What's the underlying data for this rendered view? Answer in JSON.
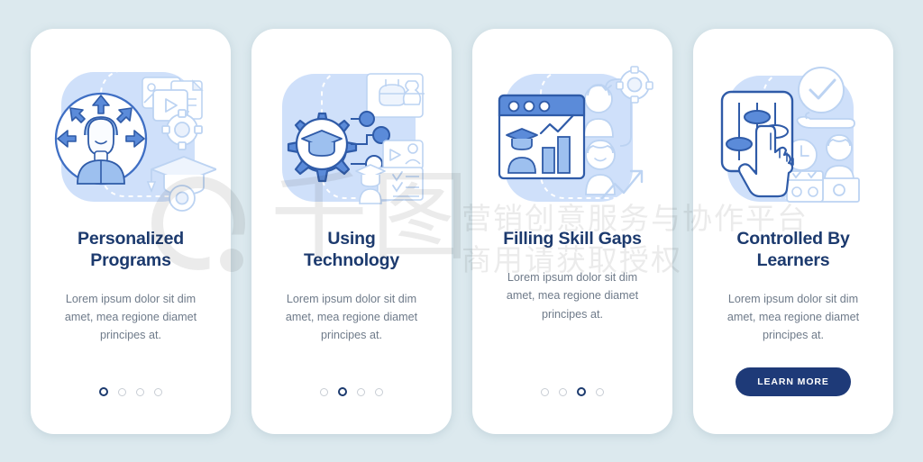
{
  "page": {
    "background_color": "#dce9ee",
    "card_background": "#ffffff",
    "title_color": "#1c3a6e",
    "body_color": "#6f7b8a",
    "accent_blue": "#5b8bd9",
    "light_blue": "#cddef7",
    "cta_color": "#1e3a78"
  },
  "watermark": {
    "brand_mark": "Q",
    "brand_cn": "千图",
    "line1": "营销创意服务与协作平台",
    "line2": "商用请获取授权"
  },
  "screens": [
    {
      "id": "personalized-programs",
      "illustration": "person-in-circle-with-arrows-media-graduation-cap-gears",
      "title": "Personalized Programs",
      "title_line1": "Personalized",
      "title_line2": "Programs",
      "body": "Lorem ipsum dolor sit dim amet, mea regione diamet principes at.",
      "footer_type": "dots",
      "dots": {
        "count": 4,
        "active_index": 0
      }
    },
    {
      "id": "using-technology",
      "illustration": "gear-with-graduation-cap-nodes-vr-headset-video-card",
      "title": "Using Technology",
      "title_line1": "Using",
      "title_line2": "Technology",
      "body": "Lorem ipsum dolor sit dim amet, mea regione diamet principes at.",
      "footer_type": "dots",
      "dots": {
        "count": 4,
        "active_index": 1
      }
    },
    {
      "id": "filling-skill-gaps",
      "illustration": "browser-window-graduate-bar-chart-people-gear-growth-arrow",
      "title": "Filling Skill Gaps",
      "title_line1": "Filling Skill Gaps",
      "title_line2": "",
      "body": "Lorem ipsum dolor sit dim amet, mea regione diamet principes at.",
      "footer_type": "dots",
      "dots": {
        "count": 4,
        "active_index": 2
      }
    },
    {
      "id": "controlled-by-learners",
      "illustration": "slider-panel-with-pointing-hand-checkmark-clock-calendar-person",
      "title": "Controlled By Learners",
      "title_line1": "Controlled By",
      "title_line2": "Learners",
      "body": "Lorem ipsum dolor sit dim amet, mea regione diamet principes at.",
      "footer_type": "button",
      "cta_label": "LEARN MORE"
    }
  ]
}
